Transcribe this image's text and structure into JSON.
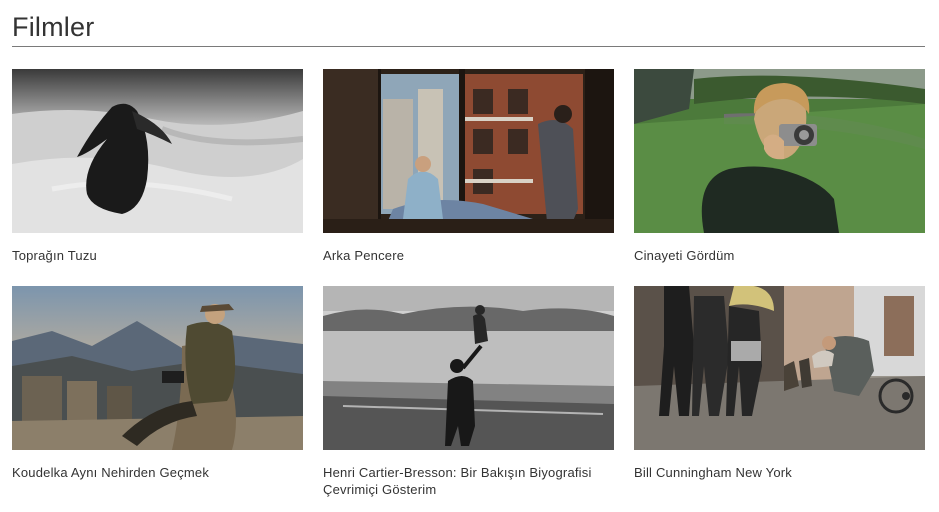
{
  "page": {
    "title": "Filmler"
  },
  "films": [
    {
      "title": "Toprağın Tuzu",
      "thumbnail": "woman-in-windswept-dunes-bw"
    },
    {
      "title": "Arka Pencere",
      "thumbnail": "man-at-apartment-window"
    },
    {
      "title": "Cinayeti Gördüm",
      "thumbnail": "woman-with-camera-in-park"
    },
    {
      "title": "Koudelka Aynı Nehirden Geçmek",
      "thumbnail": "photographer-on-stone-bench"
    },
    {
      "title": "Henri Cartier-Bresson: Bir Bakışın Biyografisi Çevrimiçi Gösterim",
      "thumbnail": "man-lifting-child-by-lake-bw"
    },
    {
      "title": "Bill Cunningham New York",
      "thumbnail": "street-photographer-crouching-in-rain"
    }
  ]
}
